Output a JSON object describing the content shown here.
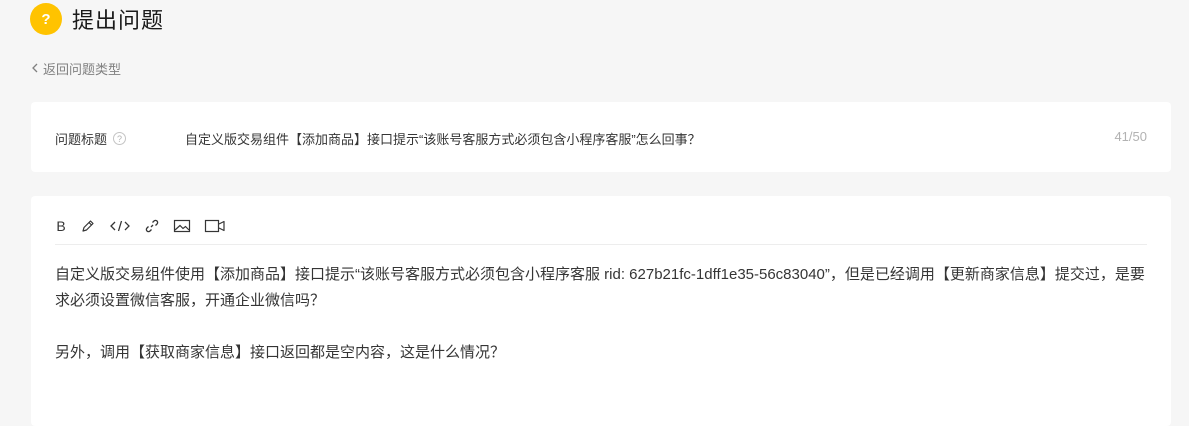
{
  "header": {
    "icon_glyph": "?",
    "title": "提出问题"
  },
  "back": {
    "label": "返回问题类型"
  },
  "question_title": {
    "label": "问题标题",
    "info_glyph": "?",
    "value": "自定义版交易组件【添加商品】接口提示“该账号客服方式必须包含小程序客服”怎么回事？",
    "count": "41/50"
  },
  "editor": {
    "toolbar": {
      "bold_label": "B"
    },
    "paragraphs": [
      "自定义版交易组件使用【添加商品】接口提示“该账号客服方式必须包含小程序客服 rid: 627b21fc-1dff1e35-56c83040”，但是已经调用【更新商家信息】提交过，是要求必须设置微信客服，开通企业微信吗？",
      "另外，调用【获取商家信息】接口返回都是空内容，这是什么情况？"
    ]
  },
  "colors": {
    "accent": "#ffc300",
    "background": "#f6f6f6",
    "card": "#ffffff",
    "muted_text": "#808080",
    "count_text": "#b2b2b2"
  }
}
